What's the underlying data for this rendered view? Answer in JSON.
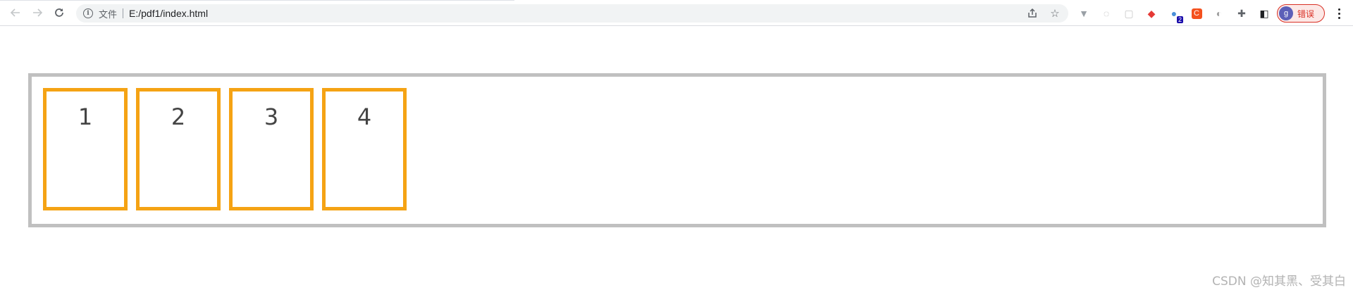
{
  "browser": {
    "back_icon": "arrow-left-icon",
    "forward_icon": "arrow-right-icon",
    "reload_icon": "reload-icon",
    "site_info_icon": "info-icon",
    "scheme_label": "文件",
    "url": "E:/pdf1/index.html",
    "share_icon": "share-icon",
    "bookmark_icon": "star-icon",
    "extensions": [
      {
        "name": "vue-devtools-icon",
        "glyph": "▼",
        "color": "#9aa0a6"
      },
      {
        "name": "circle-extension-icon",
        "glyph": "◌",
        "color": "#b0b0b0"
      },
      {
        "name": "square-extension-icon",
        "glyph": "▢",
        "color": "#c8c8c8"
      },
      {
        "name": "dice-extension-icon",
        "glyph": "◆",
        "color": "#e53935"
      },
      {
        "name": "globe-extension-icon",
        "glyph": "●",
        "color": "#4a90d9",
        "badge": "2"
      },
      {
        "name": "c-extension-icon",
        "glyph": "C",
        "color": "#ffffff",
        "bg": "#f4511e"
      },
      {
        "name": "half-circle-extension-icon",
        "glyph": "◐",
        "color": "#9e9e9e"
      },
      {
        "name": "puzzle-icon",
        "glyph": "✚",
        "color": "#5f6368"
      },
      {
        "name": "side-panel-icon",
        "glyph": "◧",
        "color": "#202124"
      }
    ],
    "profile_initial": "g",
    "profile_status": "错误",
    "menu_icon": "three-dots-icon",
    "accent_error": "#d93025"
  },
  "page": {
    "container_border_color": "#c0c0c0",
    "item_border_color": "#f5a314",
    "items": [
      {
        "label": "1"
      },
      {
        "label": "2"
      },
      {
        "label": "3"
      },
      {
        "label": "4"
      }
    ]
  },
  "watermark": "CSDN @知其黑、受其白"
}
